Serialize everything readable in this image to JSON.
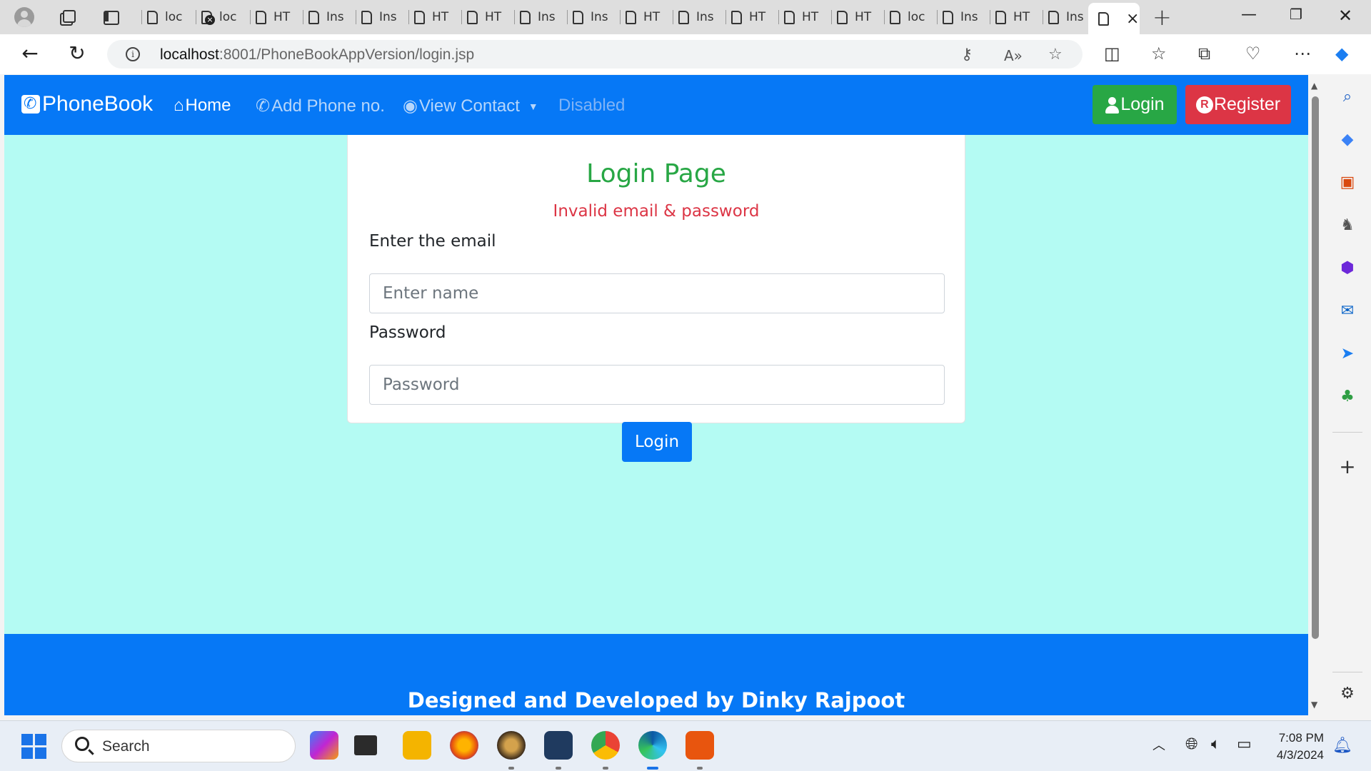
{
  "browser": {
    "tabs": [
      {
        "label": "loc"
      },
      {
        "label": "loc"
      },
      {
        "label": "HT"
      },
      {
        "label": "Ins"
      },
      {
        "label": "Ins"
      },
      {
        "label": "HT"
      },
      {
        "label": "HT"
      },
      {
        "label": "Ins"
      },
      {
        "label": "Ins"
      },
      {
        "label": "HT"
      },
      {
        "label": "Ins"
      },
      {
        "label": "HT"
      },
      {
        "label": "HT"
      },
      {
        "label": "HT"
      },
      {
        "label": "loc"
      },
      {
        "label": "Ins"
      },
      {
        "label": "HT"
      },
      {
        "label": "Ins"
      }
    ],
    "url_host": "localhost",
    "url_rest": ":8001/PhoneBookAppVersion/login.jsp"
  },
  "navbar": {
    "brand": "PhoneBook",
    "home": "Home",
    "add_phone": "Add Phone no.",
    "view_contact": "View Contact",
    "disabled": "Disabled",
    "login": "Login",
    "register": "Register"
  },
  "login_card": {
    "title": "Login Page",
    "error": "Invalid email & password",
    "email_label": "Enter the email",
    "email_placeholder": "Enter name",
    "password_label": "Password",
    "password_placeholder": "Password",
    "submit": "Login"
  },
  "footer": {
    "text": "Designed and Developed by Dinky Rajpoot"
  },
  "taskbar": {
    "search": "Search",
    "time": "7:08 PM",
    "date": "4/3/2024"
  },
  "colors": {
    "primary": "#0678f6",
    "success": "#28a745",
    "danger": "#dc3545",
    "page_bg": "#b4fbf3"
  }
}
